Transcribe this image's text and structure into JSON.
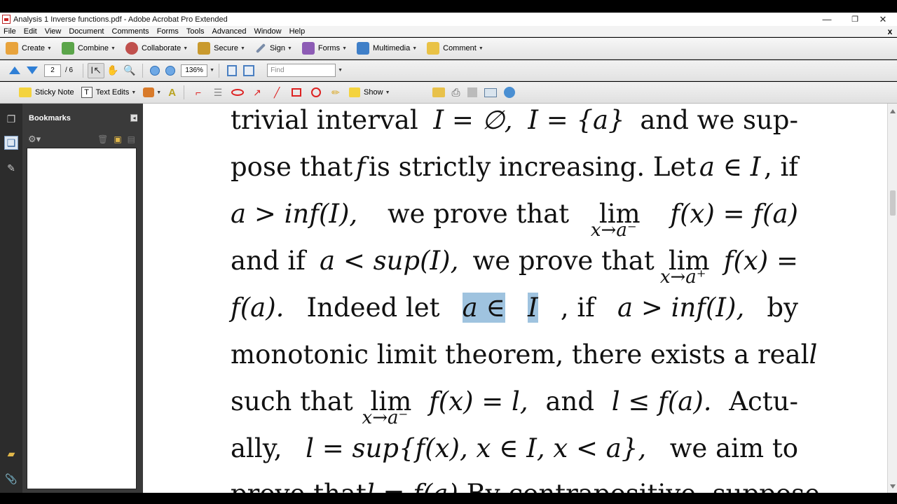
{
  "window": {
    "title": "Analysis 1 Inverse functions.pdf - Adobe Acrobat Pro Extended",
    "minimize": "—",
    "restore": "❐",
    "close": "✕"
  },
  "menu": [
    "File",
    "Edit",
    "View",
    "Document",
    "Comments",
    "Forms",
    "Tools",
    "Advanced",
    "Window",
    "Help"
  ],
  "menu_close": "x",
  "tasks": [
    {
      "label": "Create",
      "icon": "create-icon",
      "color": "#e8a33c"
    },
    {
      "label": "Combine",
      "icon": "combine-icon",
      "color": "#5ba54a"
    },
    {
      "label": "Collaborate",
      "icon": "collaborate-icon",
      "color": "#c0504d"
    },
    {
      "label": "Secure",
      "icon": "lock-icon",
      "color": "#c99a2e"
    },
    {
      "label": "Sign",
      "icon": "pen-icon",
      "color": "#7a8ca8"
    },
    {
      "label": "Forms",
      "icon": "forms-icon",
      "color": "#8d5cb5"
    },
    {
      "label": "Multimedia",
      "icon": "multimedia-icon",
      "color": "#3f7fc8"
    },
    {
      "label": "Comment",
      "icon": "comment-icon",
      "color": "#e9c246"
    }
  ],
  "nav": {
    "page_current": "2",
    "page_total": "/ 6",
    "zoom": "136%",
    "find_placeholder": "Find"
  },
  "comment_tools": {
    "sticky_note": "Sticky Note",
    "text_edits": "Text Edits",
    "show": "Show"
  },
  "bookmarks": {
    "title": "Bookmarks"
  },
  "document": {
    "highlight_color": "#9fc3df",
    "lines": [
      {
        "parts": [
          "trivial interval ",
          "I = ∅,",
          "I = {a}",
          "and we sup-"
        ]
      },
      {
        "parts": [
          "pose that ",
          "f",
          " is strictly increasing. Let ",
          "a ∈ I",
          ", if"
        ]
      },
      {
        "parts": [
          "a > inf(I),",
          " we prove that ",
          "lim",
          "f(x) = f(a)"
        ],
        "sub": "x→a⁻"
      },
      {
        "parts": [
          "and if ",
          "a < sup(I),",
          " we prove that ",
          "lim",
          "f(x) ="
        ],
        "sub": "x→a⁺"
      },
      {
        "parts": [
          "f(a).",
          "Indeed let ",
          "a ∈",
          "I",
          ", if ",
          "a > inf(I),",
          " by"
        ]
      },
      {
        "parts": [
          "monotonic limit theorem, there exists a real ",
          "l"
        ]
      },
      {
        "parts": [
          "such that ",
          "lim",
          "f(x) = l,",
          " and ",
          "l ≤ f(a).",
          " Actu-"
        ],
        "sub": "x→a⁻"
      },
      {
        "parts": [
          "ally, ",
          "l = sup{f(x), x ∈ I, x < a},",
          " we aim to"
        ]
      },
      {
        "parts": [
          "prove that ",
          "l = f(a).",
          " By contrapositive, suppose"
        ]
      }
    ]
  }
}
